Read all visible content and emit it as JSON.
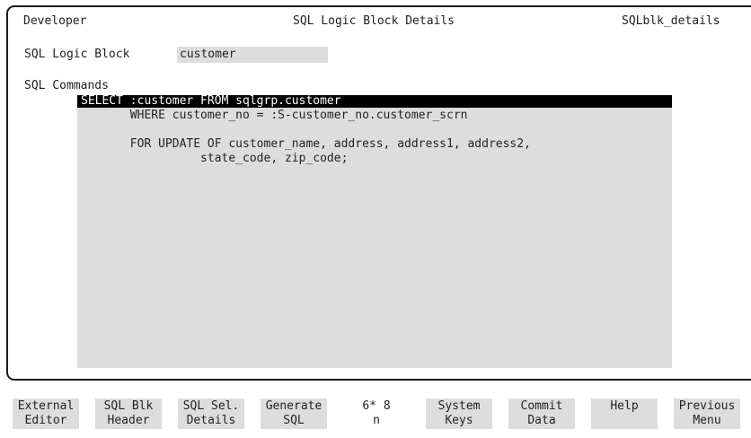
{
  "header": {
    "left": "Developer",
    "center": "SQL Logic Block Details",
    "right": "SQLblk_details"
  },
  "logic_block": {
    "label": "SQL Logic Block",
    "value": "customer"
  },
  "commands": {
    "label": "SQL Commands",
    "lines": [
      "SELECT :customer FROM sqlgrp.customer",
      "       WHERE customer_no = :S-customer_no.customer_scrn",
      "",
      "       FOR UPDATE OF customer_name, address, address1, address2,",
      "                 state_code, zip_code;"
    ]
  },
  "function_keys": [
    {
      "line1": "External",
      "line2": "Editor"
    },
    {
      "line1": "SQL Blk",
      "line2": "Header"
    },
    {
      "line1": "SQL Sel.",
      "line2": "Details"
    },
    {
      "line1": "Generate",
      "line2": "SQL"
    },
    {
      "line1": "6* 8",
      "line2": "n"
    },
    {
      "line1": "System",
      "line2": "Keys"
    },
    {
      "line1": "Commit",
      "line2": "Data"
    },
    {
      "line1": "Help",
      "line2": ""
    },
    {
      "line1": "Previous",
      "line2": "Menu"
    }
  ],
  "colors": {
    "highlight_bg": "#000000",
    "highlight_fg": "#ffffff",
    "field_stipple": "#e9e9e9",
    "border": "#1a1a1a"
  }
}
